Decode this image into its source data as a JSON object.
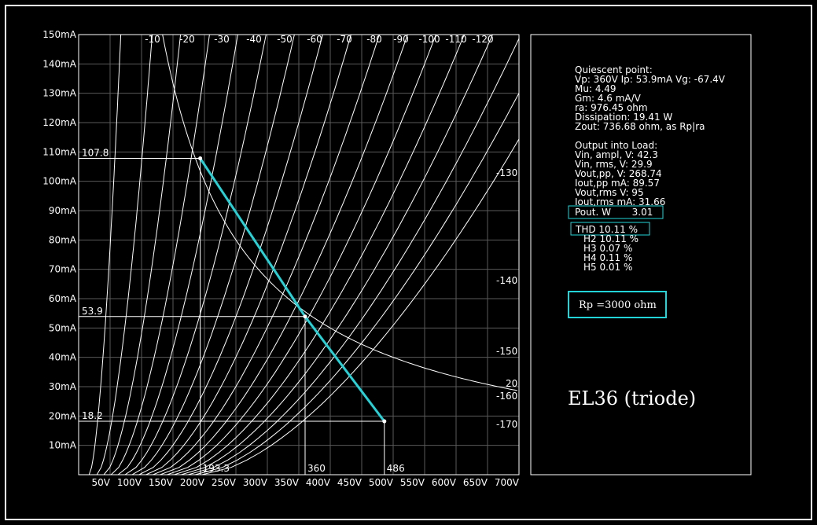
{
  "colors": {
    "background": "#000000",
    "foreground": "#ffffff",
    "grid": "#5a5a5a",
    "accent": "#22d3d8"
  },
  "chart_data": {
    "type": "line",
    "title": "EL36 (triode)",
    "xlabel": "",
    "ylabel": "",
    "xlim": [
      0,
      700
    ],
    "ylim": [
      0,
      150
    ],
    "x_ticks": [
      50,
      100,
      150,
      200,
      250,
      300,
      350,
      400,
      450,
      500,
      550,
      600,
      650,
      700
    ],
    "x_tick_labels": [
      "50V",
      "100V",
      "150V",
      "200V",
      "250V",
      "300V",
      "350V",
      "400V",
      "450V",
      "500V",
      "550V",
      "600V",
      "650V",
      "700V"
    ],
    "y_ticks": [
      10,
      20,
      30,
      40,
      50,
      60,
      70,
      80,
      90,
      100,
      110,
      120,
      130,
      140,
      150
    ],
    "y_tick_labels": [
      "10mA",
      "20mA",
      "30mA",
      "40mA",
      "50mA",
      "60mA",
      "70mA",
      "80mA",
      "90mA",
      "100mA",
      "110mA",
      "120mA",
      "130mA",
      "140mA",
      "150mA"
    ],
    "grid": true,
    "curve_labels": [
      "-10",
      "-20",
      "-30",
      "-40",
      "-50",
      "-60",
      "-70",
      "-80",
      "-90",
      "-100",
      "-110",
      "-120",
      "-130",
      "-140",
      "-150",
      "-160",
      "-170",
      "20"
    ],
    "grid_curves": {
      "vg": [
        -10,
        -20,
        -30,
        -40,
        -50,
        -60,
        -70,
        -80,
        -90,
        -100,
        -110,
        -120,
        -130,
        -140,
        -150,
        -160,
        -170
      ],
      "x_at_150mA": [
        67,
        117,
        162,
        208,
        253,
        298,
        343,
        388,
        433,
        478,
        523,
        568,
        613,
        658,
        703,
        748,
        793
      ],
      "exponent": 1.6,
      "knee_frac": 0.55
    },
    "dissipation_curve": {
      "watts": 20,
      "label": "20"
    },
    "load_line": {
      "rp_ohm": 3000,
      "points": [
        {
          "x": 193.3,
          "y": 107.8
        },
        {
          "x": 360,
          "y": 53.9
        },
        {
          "x": 486,
          "y": 18.2
        }
      ]
    },
    "markers": {
      "y": [
        {
          "value": 107.8,
          "label": "107.8"
        },
        {
          "value": 53.9,
          "label": "53.9"
        },
        {
          "value": 18.2,
          "label": "18.2"
        }
      ],
      "x": [
        {
          "value": 193.3,
          "label": "193.3"
        },
        {
          "value": 360,
          "label": "360"
        },
        {
          "value": 486,
          "label": "486"
        }
      ]
    }
  },
  "info": {
    "quiescent_title": "Quiescent point:",
    "lines": [
      "Vp: 360V  Ip: 53.9mA  Vg: -67.4V",
      "Mu: 4.49",
      "Gm: 4.6 mA/V",
      "ra: 976.45 ohm",
      "Dissipation: 19.41 W",
      "Zout: 736.68 ohm, as Rp|ra"
    ],
    "output_title": "Output into Load:",
    "output_lines": [
      "Vin, ampl, V: 42.3",
      "Vin, rms,  V: 29.9",
      "Vout,pp,   V: 268.74",
      "Iout,pp    mA: 89.57",
      "Vout,rms   V: 95",
      "Iout,rms  mA: 31.66"
    ],
    "pout": "Pout. W       3.01",
    "thd": "THD 10.11 %",
    "harmonics": [
      "H2 10.11 %",
      "H3 0.07 %",
      "H4 0.11 %",
      "H5 0.01 %"
    ],
    "rp_box": "Rp =3000 ohm"
  }
}
